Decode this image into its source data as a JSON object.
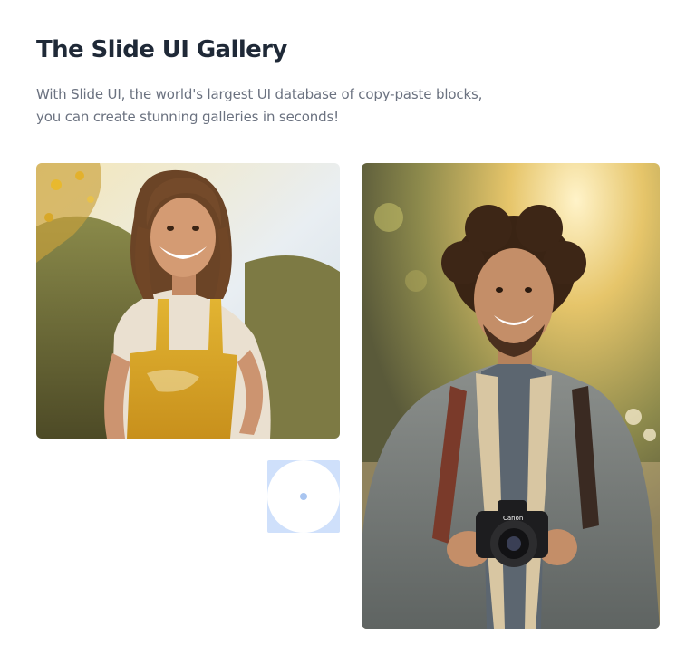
{
  "gallery": {
    "title": "The Slide UI Gallery",
    "description_lines": [
      "With Slide UI, the world's largest UI database of copy-paste blocks,",
      "you can create stunning galleries in seconds!"
    ]
  },
  "images": [
    {
      "subject": "smiling woman in yellow overalls in a sunny field"
    },
    {
      "subject": "smiling man with curly hair holding a camera outdoors",
      "camera_brand": "Canon"
    }
  ],
  "placeholder": {
    "icon": "image-placeholder-icon"
  },
  "colors": {
    "heading": "#1f2937",
    "body_text": "#6b7280",
    "placeholder_bg": "#cfe0fb"
  }
}
